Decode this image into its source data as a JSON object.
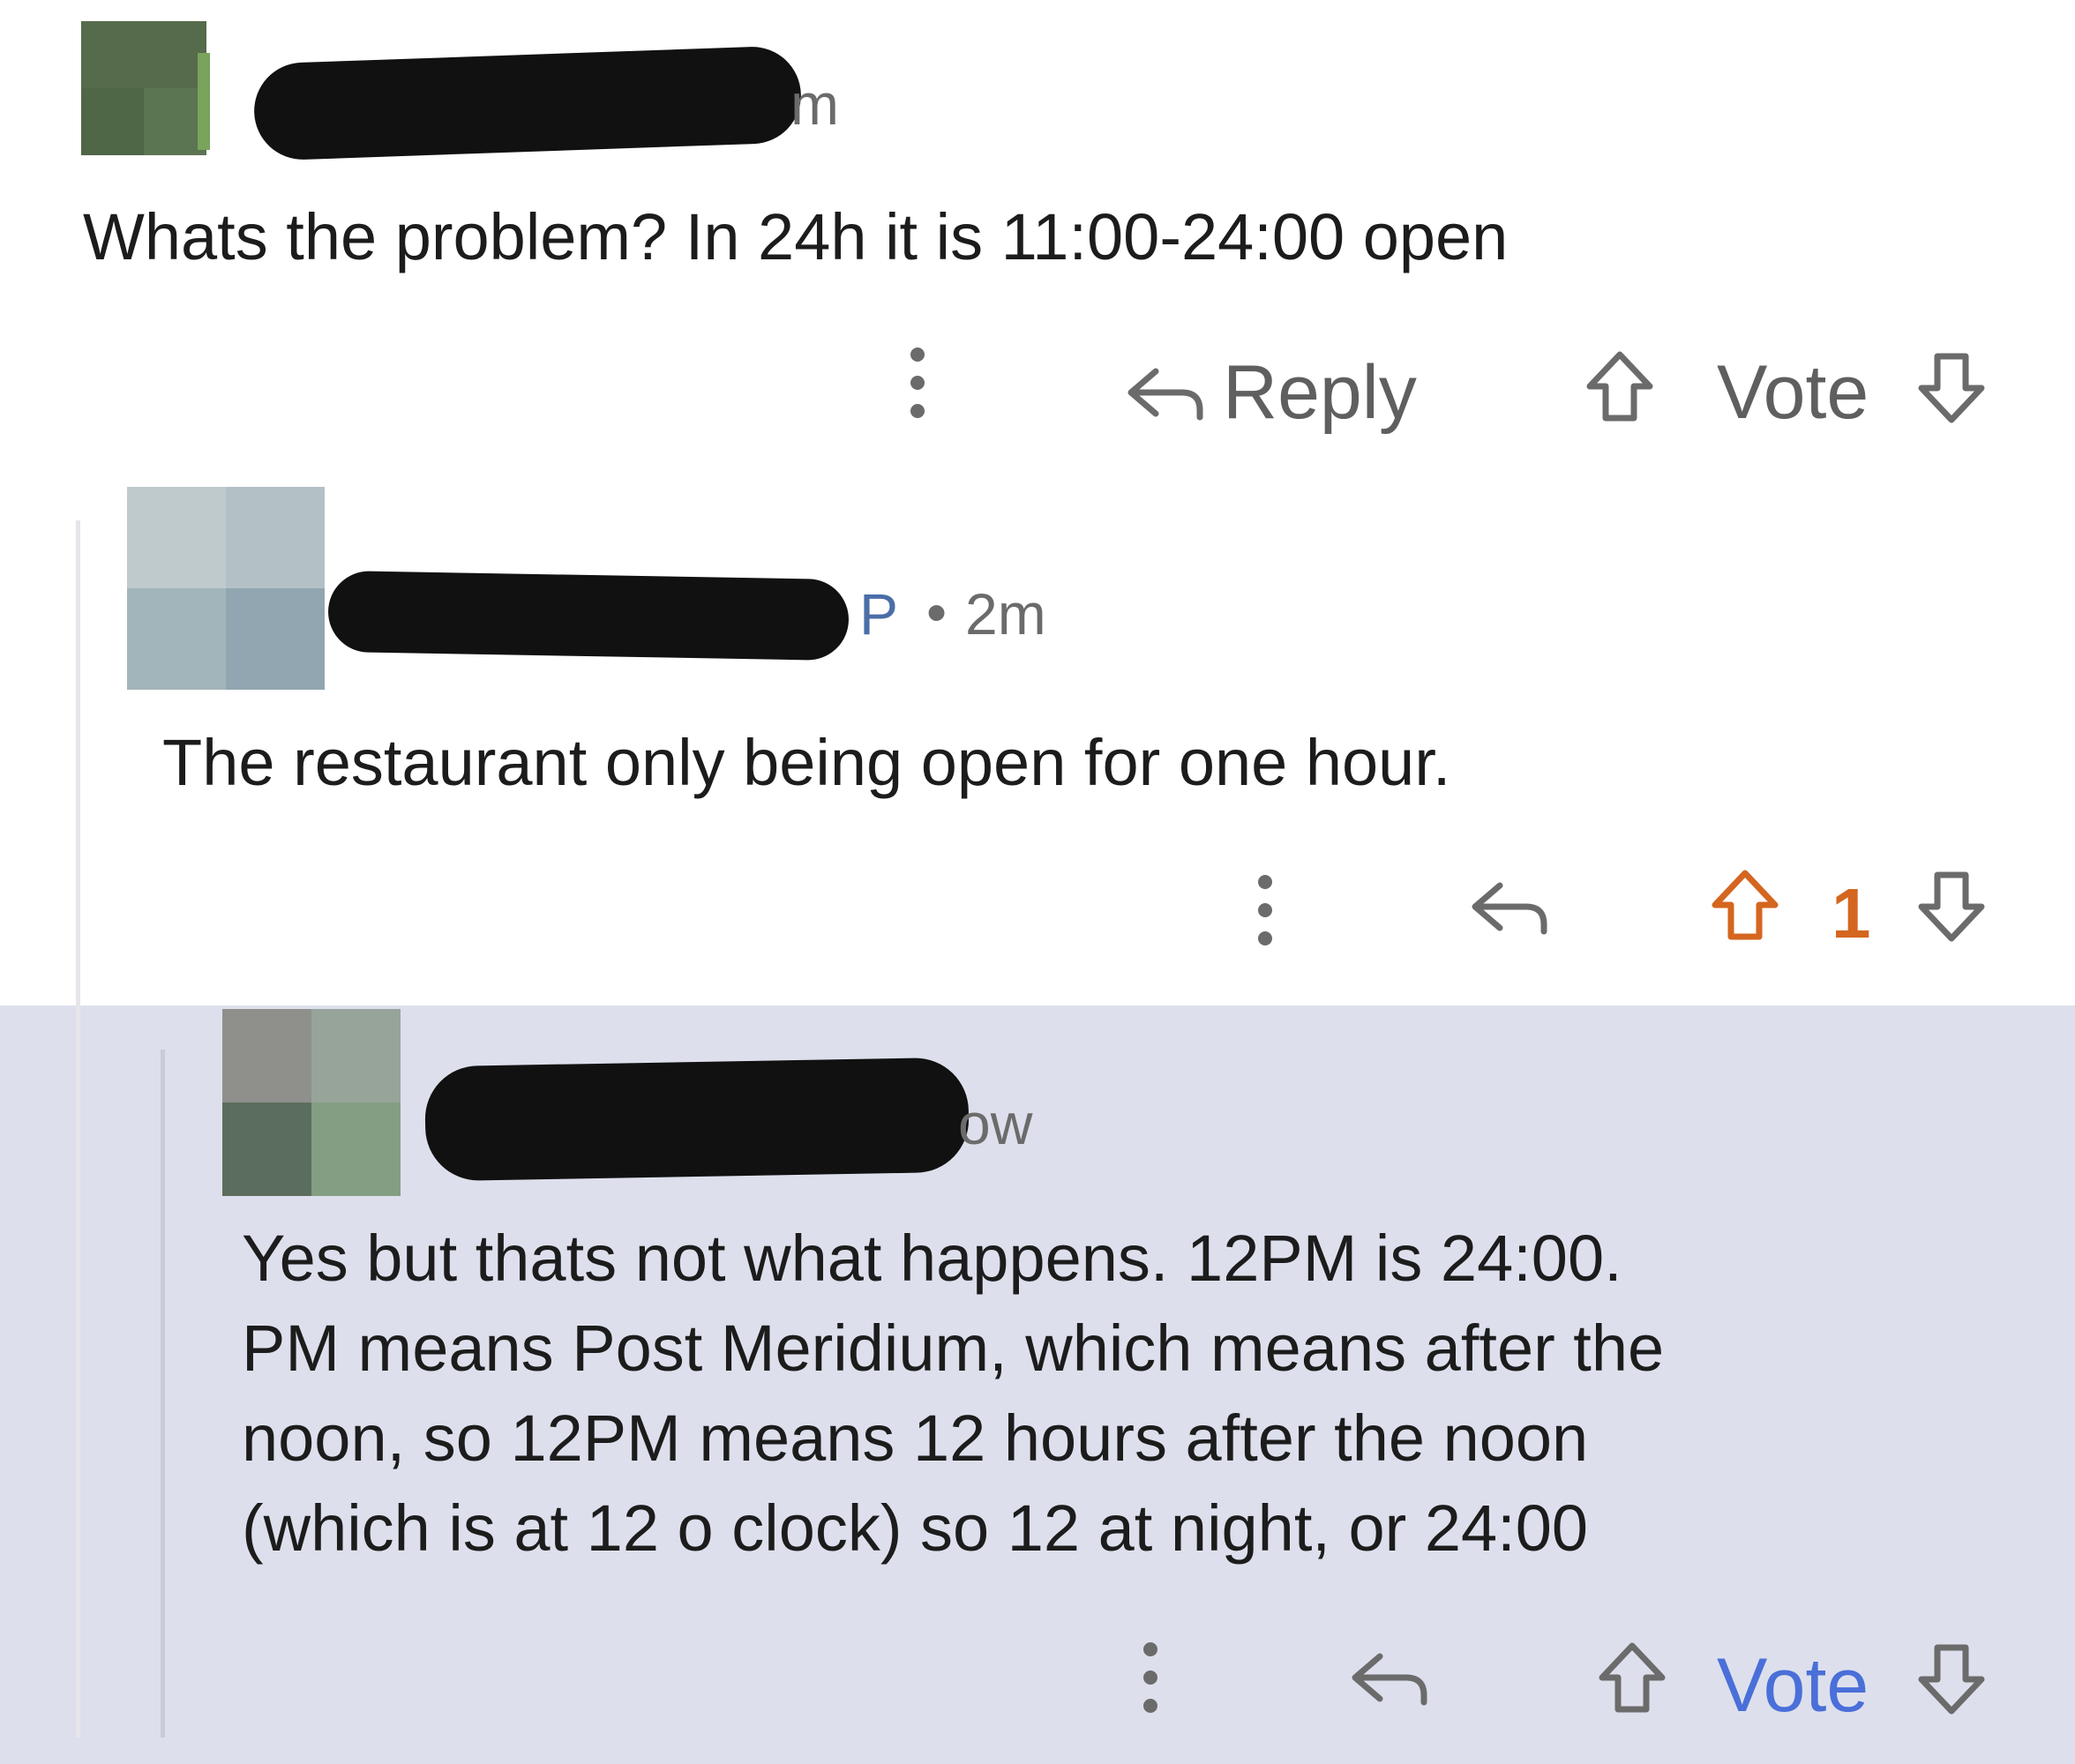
{
  "comments": [
    {
      "timestamp_fragment": "m",
      "body": "Whats the problem? In 24h it is 11:00-24:00 open",
      "more_icon": "more-vertical-icon",
      "reply_label": "Reply",
      "vote_label": "Vote",
      "vote_color": "#6b6b6b"
    },
    {
      "op_fragment": "P",
      "separator": "•",
      "timestamp": "2m",
      "body": "The restaurant only being open for one hour.",
      "vote_count": "1",
      "vote_color": "#d4661f"
    },
    {
      "timestamp_fragment": "ow",
      "body_lines": [
        "Yes but thats not what happens. 12PM is 24:00.",
        "PM means Post Meridium, which means after the",
        "noon, so 12PM means 12 hours after the noon",
        "(which is at 12 o clock) so 12 at night, or 24:00"
      ],
      "vote_label": "Vote",
      "vote_color": "#4a6fd8",
      "highlight_color": "#dde0ec"
    }
  ],
  "icons": {
    "reply": "reply-arrow-icon",
    "upvote": "upvote-arrow-icon",
    "downvote": "downvote-arrow-icon",
    "more": "more-vertical-icon"
  }
}
